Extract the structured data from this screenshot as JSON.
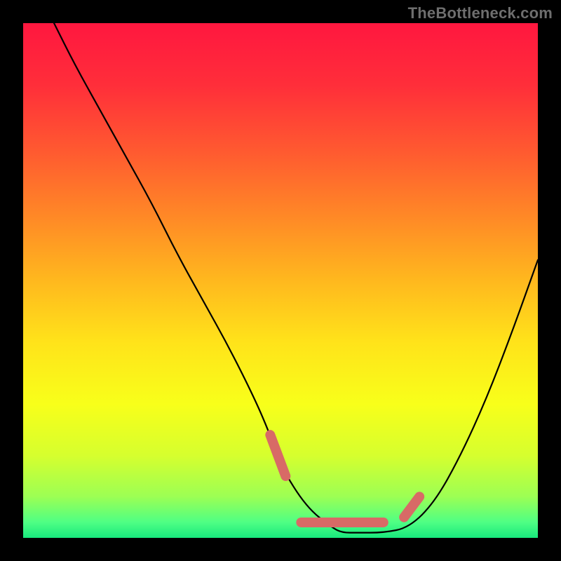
{
  "watermark": "TheBottleneck.com",
  "gradient_stops": [
    {
      "offset": 0.0,
      "color": "#ff173f"
    },
    {
      "offset": 0.12,
      "color": "#ff2e3a"
    },
    {
      "offset": 0.25,
      "color": "#ff5a30"
    },
    {
      "offset": 0.38,
      "color": "#ff8a26"
    },
    {
      "offset": 0.5,
      "color": "#ffb81e"
    },
    {
      "offset": 0.62,
      "color": "#ffe31a"
    },
    {
      "offset": 0.74,
      "color": "#f8ff1a"
    },
    {
      "offset": 0.84,
      "color": "#d6ff2e"
    },
    {
      "offset": 0.92,
      "color": "#9cff54"
    },
    {
      "offset": 0.97,
      "color": "#4eff84"
    },
    {
      "offset": 1.0,
      "color": "#18e97d"
    }
  ],
  "chart_data": {
    "type": "line",
    "title": "",
    "xlabel": "",
    "ylabel": "",
    "xlim": [
      0,
      100
    ],
    "ylim": [
      0,
      100
    ],
    "grid": false,
    "series": [
      {
        "name": "bottleneck-curve",
        "x": [
          6,
          10,
          15,
          20,
          25,
          30,
          35,
          40,
          45,
          48,
          50,
          55,
          60,
          62,
          65,
          70,
          75,
          80,
          85,
          90,
          95,
          100
        ],
        "y": [
          100,
          92,
          83,
          74,
          65,
          55,
          46,
          37,
          27,
          20,
          14,
          6,
          2,
          1,
          1,
          1,
          2,
          7,
          16,
          27,
          40,
          54
        ]
      }
    ],
    "highlight": {
      "name": "flat-bottom",
      "color": "#d86a66",
      "segments": [
        {
          "x": [
            48,
            51
          ],
          "y": [
            20,
            12
          ]
        },
        {
          "x": [
            54,
            70
          ],
          "y": [
            3,
            3
          ]
        },
        {
          "x": [
            74,
            77
          ],
          "y": [
            4,
            8
          ]
        }
      ]
    }
  }
}
